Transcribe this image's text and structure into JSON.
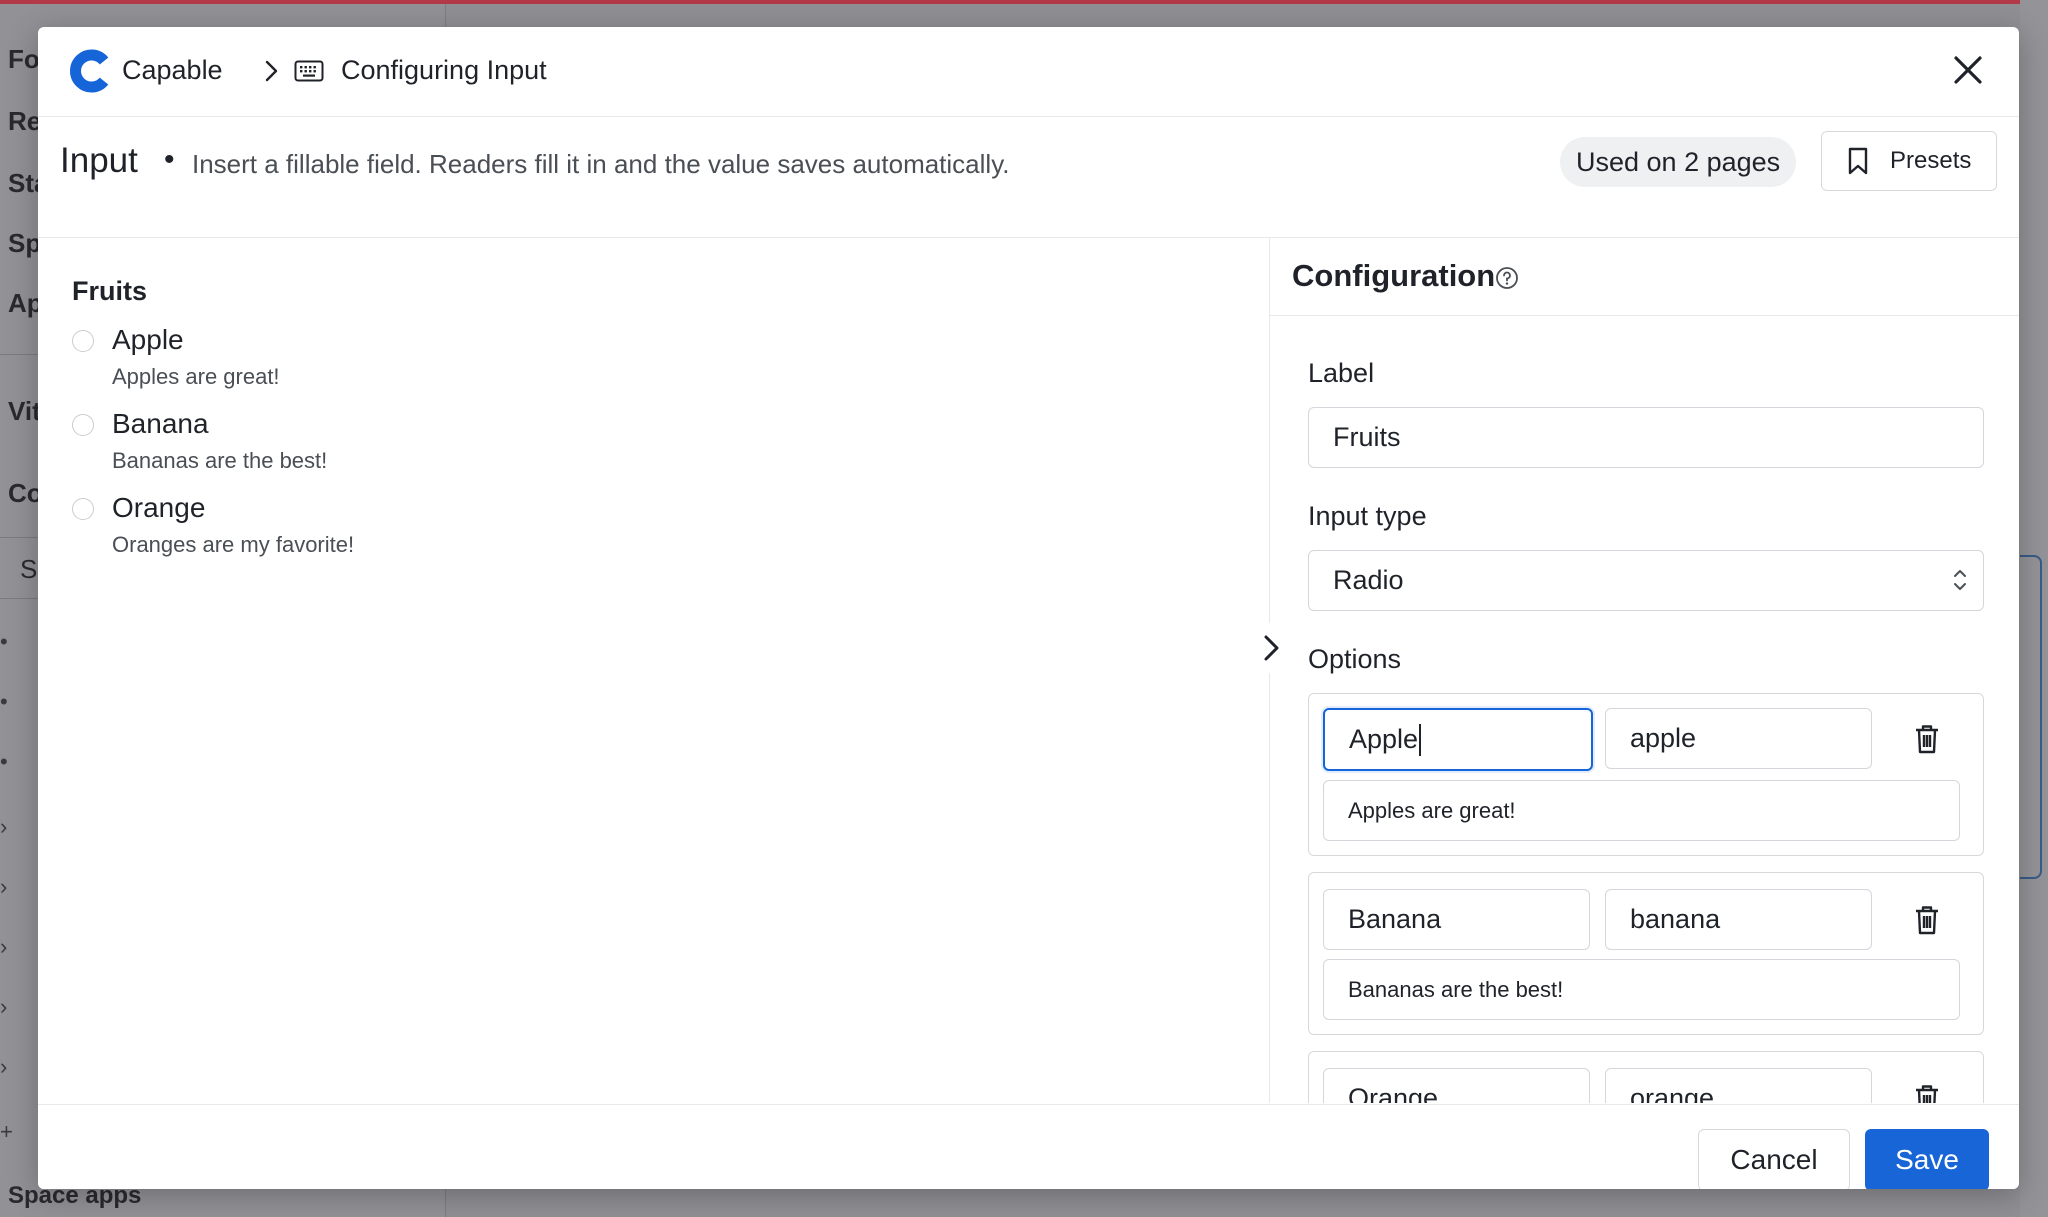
{
  "background": {
    "sidebar_items": [
      "Fo",
      "Re",
      "Sta",
      "Sp",
      "Ap",
      "Vit",
      "Co"
    ],
    "search_stub": "S",
    "bottom_label": "Space apps"
  },
  "header": {
    "brand": "Capable",
    "breadcrumb_title": "Configuring Input",
    "icons": [
      "capable-logo",
      "chevron-right-icon",
      "keyboard-icon",
      "close-icon"
    ]
  },
  "subheader": {
    "title": "Input",
    "separator": "•",
    "description": "Insert a fillable field. Readers fill it in and the value saves automatically.",
    "usage_badge": "Used on 2 pages",
    "presets_label": "Presets"
  },
  "preview": {
    "field_label": "Fruits",
    "options": [
      {
        "label": "Apple",
        "description": "Apples are great!"
      },
      {
        "label": "Banana",
        "description": "Bananas are the best!"
      },
      {
        "label": "Orange",
        "description": "Oranges are my favorite!"
      }
    ]
  },
  "config": {
    "title": "Configuration",
    "label_field": {
      "label": "Label",
      "value": "Fruits"
    },
    "input_type": {
      "label": "Input type",
      "value": "Radio"
    },
    "options_label": "Options",
    "options": [
      {
        "label": "Apple",
        "value": "apple",
        "description": "Apples are great!"
      },
      {
        "label": "Banana",
        "value": "banana",
        "description": "Bananas are the best!"
      },
      {
        "label": "Orange",
        "value": "orange",
        "description": ""
      }
    ]
  },
  "footer": {
    "cancel_label": "Cancel",
    "save_label": "Save"
  },
  "colors": {
    "accent": "#1765d6",
    "overlay": "#8f8f94",
    "border": "#d6d9dc"
  }
}
